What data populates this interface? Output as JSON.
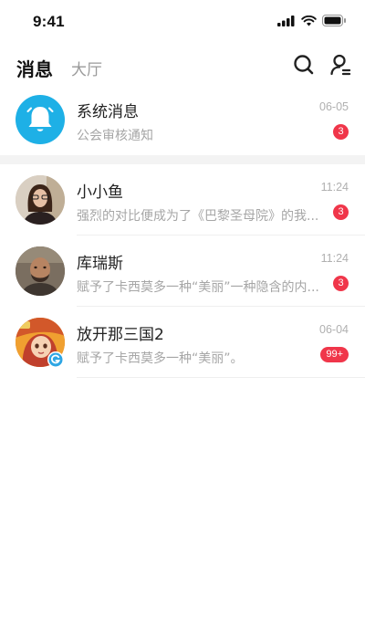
{
  "status_bar": {
    "time": "9:41"
  },
  "header": {
    "tabs": [
      {
        "label": "消息",
        "active": true
      },
      {
        "label": "大厅",
        "active": false
      }
    ],
    "icons": {
      "search": "search-icon",
      "profile": "user-icon"
    }
  },
  "colors": {
    "accent_blue": "#1eb0e6",
    "badge_red": "#f0364a",
    "muted_text": "#a6a6a6"
  },
  "messages": [
    {
      "name": "系统消息",
      "preview": "公会审核通知",
      "time": "06-05",
      "badge": "3",
      "avatar_icon": "bell-icon"
    },
    {
      "name": "小小鱼",
      "preview": "强烈的对比便成为了《巴黎圣母院》的我...",
      "time": "11:24",
      "badge": "3",
      "avatar_icon": "user-photo"
    },
    {
      "name": "库瑞斯",
      "preview": "赋予了卡西莫多一种“美丽”一种隐含的内...",
      "time": "11:24",
      "badge": "3",
      "avatar_icon": "user-photo"
    },
    {
      "name": "放开那三国2",
      "preview": "赋予了卡西莫多一种“美丽”。",
      "time": "06-04",
      "badge": "99+",
      "avatar_icon": "game-avatar",
      "sub_icon": "g-badge-icon"
    }
  ]
}
